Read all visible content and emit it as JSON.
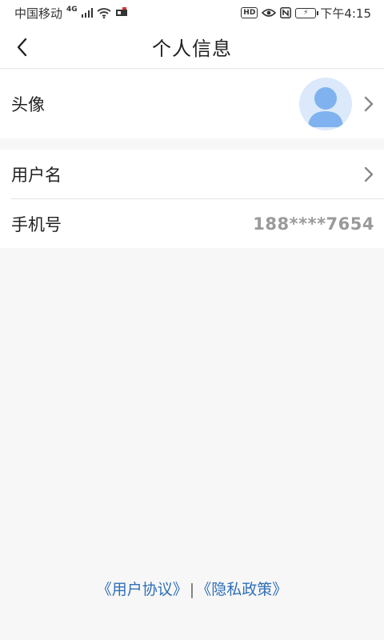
{
  "status_bar": {
    "carrier": "中国移动",
    "network": "4G",
    "time": "下午4:15",
    "hd": "HD",
    "icons": [
      "signal-icon",
      "wifi-icon",
      "notification-icon",
      "eye-icon",
      "nfc-icon",
      "battery-icon"
    ]
  },
  "header": {
    "title": "个人信息",
    "back_icon": "chevron-left-icon"
  },
  "profile": {
    "avatar_row": {
      "label": "头像"
    },
    "username_row": {
      "label": "用户名",
      "value": ""
    },
    "phone_row": {
      "label": "手机号",
      "value": "188****7654"
    }
  },
  "footer": {
    "user_agreement": "《用户协议》",
    "separator": "|",
    "privacy_policy": "《隐私政策》"
  },
  "colors": {
    "background": "#f7f7f7",
    "link": "#2f6fb8",
    "avatar_bg": "#dbe9fb",
    "avatar_fg": "#7fb2ee",
    "value_gray": "#9a9a9a"
  }
}
